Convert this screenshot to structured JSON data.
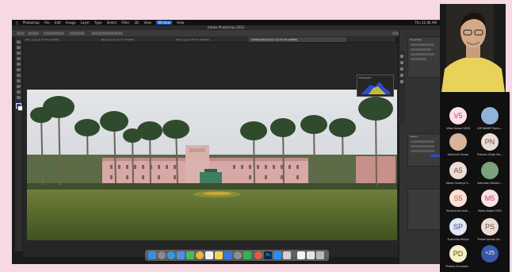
{
  "mac_menubar": {
    "items": [
      "Photoshop",
      "File",
      "Edit",
      "Image",
      "Layer",
      "Type",
      "Select",
      "Filter",
      "3D",
      "View",
      "Window",
      "Help"
    ],
    "clock": "Thu 11:06 AM"
  },
  "photoshop": {
    "app_title": "Adobe Photoshop 2022",
    "tabs": [
      "IMG_1.jpg @ 16.7% (RGB/8)",
      "IMG_2.jpg @ 16.7% (RGB/8)",
      "IMG_3.jpg @ 16.7% (RGB/8)",
      "Untitled-Panorama-1 @ 16.7% (RGB/8)"
    ],
    "panels": {
      "histogram_title": "Histogram",
      "layers_title": "Layers",
      "properties_title": "Properties"
    },
    "colors": {
      "foreground": "#1a3be0",
      "background": "#ffffff"
    }
  },
  "dock": {
    "icons": [
      "finder-icon",
      "launchpad-icon",
      "safari-icon",
      "mail-icon",
      "facetime-icon",
      "chrome-icon",
      "calendar-icon",
      "notes-icon",
      "appstore-icon",
      "settings-icon",
      "whatsapp-icon",
      "chrome-alt-icon",
      "photoshop-icon",
      "zoom-icon",
      "keyboard-icon",
      "word-icon",
      "doc-icon",
      "trash-icon"
    ]
  },
  "meeting": {
    "participants": [
      {
        "initials": "V5",
        "name": "Vikas Kumar 5878",
        "color": "#cf3f62",
        "bg": "#fbe0e7"
      },
      {
        "initials": "",
        "name": "IDP NAHEP Panto...",
        "color": "#4b6a3b",
        "bg": "#8fb3d9"
      },
      {
        "initials": "",
        "name": "Abhishek Kumar",
        "color": "#7a4a3a",
        "bg": "#d9b49a"
      },
      {
        "initials": "PN",
        "name": "Prakash Singh Ne...",
        "color": "#6f5146",
        "bg": "#ebdcd5"
      },
      {
        "initials": "A5",
        "name": "Akash Gulariya 3...",
        "color": "#6f5146",
        "bg": "#ebdcd5"
      },
      {
        "initials": "",
        "name": "Ashutosh Dhoom...",
        "color": "#2f5d3c",
        "bg": "#7aa37d"
      },
      {
        "initials": "S5",
        "name": "Shubhendu Kulk...",
        "color": "#c45a2c",
        "bg": "#fbe2d6"
      },
      {
        "initials": "M5",
        "name": "Mohd Abbas 5583",
        "color": "#cf3f62",
        "bg": "#fbe0e7"
      },
      {
        "initials": "SP",
        "name": "Sushmita Paliyal",
        "color": "#3c4b6b",
        "bg": "#dfe6f5"
      },
      {
        "initials": "PS",
        "name": "Pritam Kumar Sa...",
        "color": "#6f5146",
        "bg": "#ebdcd5"
      },
      {
        "initials": "PD",
        "name": "Prabha Dumroah...",
        "color": "#5b4a13",
        "bg": "#f8efc7"
      },
      {
        "initials": "+25",
        "name": "",
        "color": "#ffffff",
        "bg": "#3a58a8"
      }
    ]
  }
}
